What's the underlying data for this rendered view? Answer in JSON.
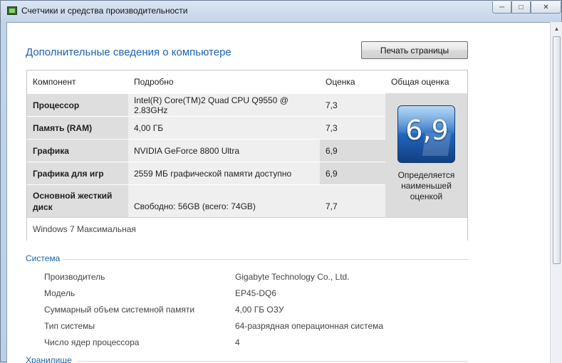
{
  "window": {
    "title": "Счетчики и средства производительности",
    "min_icon": "minimize-icon",
    "max_icon": "maximize-icon",
    "close_icon": "close-icon"
  },
  "page": {
    "heading": "Дополнительные сведения о компьютере",
    "print_label": "Печать страницы"
  },
  "table": {
    "headers": {
      "component": "Компонент",
      "details": "Подробно",
      "score": "Оценка",
      "base": "Общая оценка"
    },
    "rows": [
      {
        "component": "Процессор",
        "details": "Intel(R) Core(TM)2 Quad CPU Q9550 @ 2.83GHz",
        "score": "7,3"
      },
      {
        "component": "Память (RAM)",
        "details": "4,00 ГБ",
        "score": "7,3"
      },
      {
        "component": "Графика",
        "details": "NVIDIA GeForce 8800 Ultra",
        "score": "6,9"
      },
      {
        "component": "Графика для игр",
        "details": "2559 МБ графической памяти доступно",
        "score": "6,9"
      },
      {
        "component": "Основной жесткий диск",
        "details": "Свободно: 56GB (всего: 74GB)",
        "score": "7,7"
      }
    ],
    "base_score": "6,9",
    "base_caption": "Определяется наименьшей оценкой",
    "edition": "Windows 7 Максимальная"
  },
  "system": {
    "title": "Система",
    "properties": [
      {
        "label": "Производитель",
        "value": "Gigabyte Technology Co., Ltd."
      },
      {
        "label": "Модель",
        "value": "EP45-DQ6"
      },
      {
        "label": "Суммарный объем системной памяти",
        "value": "4,00 ГБ ОЗУ"
      },
      {
        "label": "Тип системы",
        "value": "64-разрядная операционная система"
      },
      {
        "label": "Число ядер процессора",
        "value": "4"
      }
    ]
  },
  "storage": {
    "title": "Хранилище"
  },
  "colors": {
    "accent": "#1a64ab",
    "badge": "#1f62b7"
  }
}
